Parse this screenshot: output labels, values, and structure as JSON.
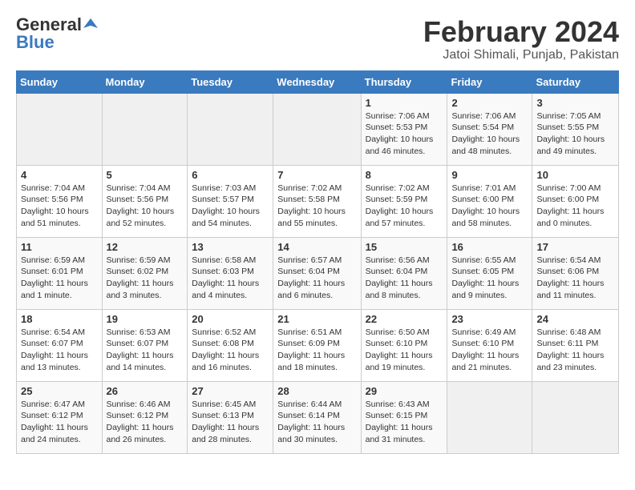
{
  "header": {
    "logo_general": "General",
    "logo_blue": "Blue",
    "month_year": "February 2024",
    "location": "Jatoi Shimali, Punjab, Pakistan"
  },
  "weekdays": [
    "Sunday",
    "Monday",
    "Tuesday",
    "Wednesday",
    "Thursday",
    "Friday",
    "Saturday"
  ],
  "weeks": [
    [
      {
        "day": "",
        "info": ""
      },
      {
        "day": "",
        "info": ""
      },
      {
        "day": "",
        "info": ""
      },
      {
        "day": "",
        "info": ""
      },
      {
        "day": "1",
        "info": "Sunrise: 7:06 AM\nSunset: 5:53 PM\nDaylight: 10 hours\nand 46 minutes."
      },
      {
        "day": "2",
        "info": "Sunrise: 7:06 AM\nSunset: 5:54 PM\nDaylight: 10 hours\nand 48 minutes."
      },
      {
        "day": "3",
        "info": "Sunrise: 7:05 AM\nSunset: 5:55 PM\nDaylight: 10 hours\nand 49 minutes."
      }
    ],
    [
      {
        "day": "4",
        "info": "Sunrise: 7:04 AM\nSunset: 5:56 PM\nDaylight: 10 hours\nand 51 minutes."
      },
      {
        "day": "5",
        "info": "Sunrise: 7:04 AM\nSunset: 5:56 PM\nDaylight: 10 hours\nand 52 minutes."
      },
      {
        "day": "6",
        "info": "Sunrise: 7:03 AM\nSunset: 5:57 PM\nDaylight: 10 hours\nand 54 minutes."
      },
      {
        "day": "7",
        "info": "Sunrise: 7:02 AM\nSunset: 5:58 PM\nDaylight: 10 hours\nand 55 minutes."
      },
      {
        "day": "8",
        "info": "Sunrise: 7:02 AM\nSunset: 5:59 PM\nDaylight: 10 hours\nand 57 minutes."
      },
      {
        "day": "9",
        "info": "Sunrise: 7:01 AM\nSunset: 6:00 PM\nDaylight: 10 hours\nand 58 minutes."
      },
      {
        "day": "10",
        "info": "Sunrise: 7:00 AM\nSunset: 6:00 PM\nDaylight: 11 hours\nand 0 minutes."
      }
    ],
    [
      {
        "day": "11",
        "info": "Sunrise: 6:59 AM\nSunset: 6:01 PM\nDaylight: 11 hours\nand 1 minute."
      },
      {
        "day": "12",
        "info": "Sunrise: 6:59 AM\nSunset: 6:02 PM\nDaylight: 11 hours\nand 3 minutes."
      },
      {
        "day": "13",
        "info": "Sunrise: 6:58 AM\nSunset: 6:03 PM\nDaylight: 11 hours\nand 4 minutes."
      },
      {
        "day": "14",
        "info": "Sunrise: 6:57 AM\nSunset: 6:04 PM\nDaylight: 11 hours\nand 6 minutes."
      },
      {
        "day": "15",
        "info": "Sunrise: 6:56 AM\nSunset: 6:04 PM\nDaylight: 11 hours\nand 8 minutes."
      },
      {
        "day": "16",
        "info": "Sunrise: 6:55 AM\nSunset: 6:05 PM\nDaylight: 11 hours\nand 9 minutes."
      },
      {
        "day": "17",
        "info": "Sunrise: 6:54 AM\nSunset: 6:06 PM\nDaylight: 11 hours\nand 11 minutes."
      }
    ],
    [
      {
        "day": "18",
        "info": "Sunrise: 6:54 AM\nSunset: 6:07 PM\nDaylight: 11 hours\nand 13 minutes."
      },
      {
        "day": "19",
        "info": "Sunrise: 6:53 AM\nSunset: 6:07 PM\nDaylight: 11 hours\nand 14 minutes."
      },
      {
        "day": "20",
        "info": "Sunrise: 6:52 AM\nSunset: 6:08 PM\nDaylight: 11 hours\nand 16 minutes."
      },
      {
        "day": "21",
        "info": "Sunrise: 6:51 AM\nSunset: 6:09 PM\nDaylight: 11 hours\nand 18 minutes."
      },
      {
        "day": "22",
        "info": "Sunrise: 6:50 AM\nSunset: 6:10 PM\nDaylight: 11 hours\nand 19 minutes."
      },
      {
        "day": "23",
        "info": "Sunrise: 6:49 AM\nSunset: 6:10 PM\nDaylight: 11 hours\nand 21 minutes."
      },
      {
        "day": "24",
        "info": "Sunrise: 6:48 AM\nSunset: 6:11 PM\nDaylight: 11 hours\nand 23 minutes."
      }
    ],
    [
      {
        "day": "25",
        "info": "Sunrise: 6:47 AM\nSunset: 6:12 PM\nDaylight: 11 hours\nand 24 minutes."
      },
      {
        "day": "26",
        "info": "Sunrise: 6:46 AM\nSunset: 6:12 PM\nDaylight: 11 hours\nand 26 minutes."
      },
      {
        "day": "27",
        "info": "Sunrise: 6:45 AM\nSunset: 6:13 PM\nDaylight: 11 hours\nand 28 minutes."
      },
      {
        "day": "28",
        "info": "Sunrise: 6:44 AM\nSunset: 6:14 PM\nDaylight: 11 hours\nand 30 minutes."
      },
      {
        "day": "29",
        "info": "Sunrise: 6:43 AM\nSunset: 6:15 PM\nDaylight: 11 hours\nand 31 minutes."
      },
      {
        "day": "",
        "info": ""
      },
      {
        "day": "",
        "info": ""
      }
    ]
  ]
}
